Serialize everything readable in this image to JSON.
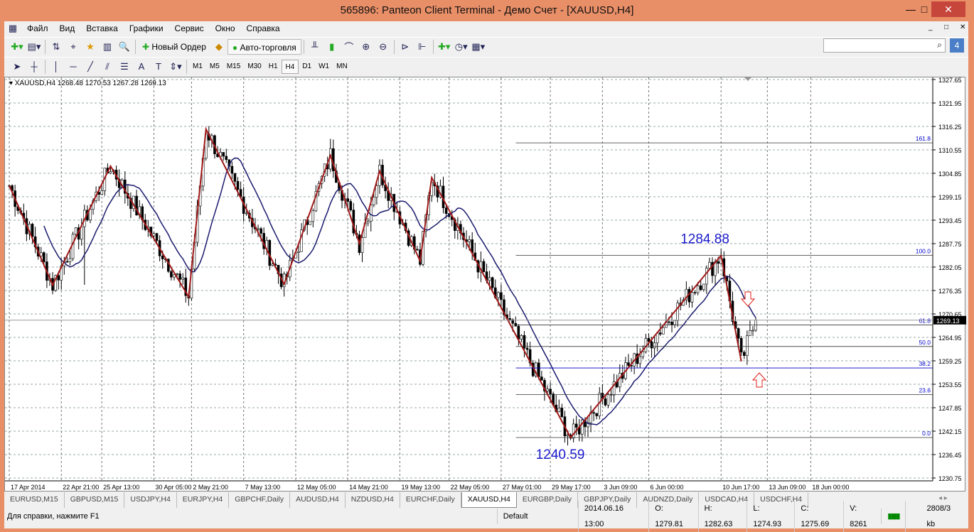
{
  "window": {
    "title": "565896: Panteon Client Terminal - Демо Счет - [XAUUSD,H4]"
  },
  "menu": [
    "Файл",
    "Вид",
    "Вставка",
    "Графики",
    "Сервис",
    "Окно",
    "Справка"
  ],
  "toolbar": {
    "new_order": "Новый Ордер",
    "auto_trading": "Авто-торговля"
  },
  "timeframes": [
    "M1",
    "M5",
    "M15",
    "M30",
    "H1",
    "H4",
    "D1",
    "W1",
    "MN"
  ],
  "active_timeframe": "H4",
  "chart_data": {
    "type": "candlestick",
    "symbol_info": "XAUUSD,H4  1268.48 1270.53 1267.28 1269.13",
    "y_ticks": [
      "1327.65",
      "1321.95",
      "1316.25",
      "1310.55",
      "1304.85",
      "1299.15",
      "1293.45",
      "1287.75",
      "1282.05",
      "1276.35",
      "1270.65",
      "1264.95",
      "1259.25",
      "1253.55",
      "1247.85",
      "1242.15",
      "1236.45",
      "1230.75"
    ],
    "ylim": [
      1230.75,
      1327.65
    ],
    "x_ticks": [
      "17 Apr 2014",
      "22 Apr 21:00",
      "25 Apr 13:00",
      "30 Apr 05:00",
      "2 May 21:00",
      "7 May 13:00",
      "12 May 05:00",
      "14 May 21:00",
      "19 May 13:00",
      "22 May 05:00",
      "27 May 01:00",
      "29 May 17:00",
      "3 Jun 09:00",
      "6 Jun 00:00",
      "10 Jun 17:00",
      "13 Jun 09:00",
      "18 Jun 00:00"
    ],
    "current_price": "1269.13",
    "zigzag": [
      [
        0,
        1301.9
      ],
      [
        15,
        1277.7
      ],
      [
        35,
        1306.6
      ],
      [
        62,
        1274.8
      ],
      [
        68,
        1315.6
      ],
      [
        95,
        1277.9
      ],
      [
        111,
        1309.2
      ],
      [
        121,
        1287.8
      ],
      [
        128,
        1305.4
      ],
      [
        142,
        1283.5
      ],
      [
        146,
        1303.8
      ],
      [
        194,
        1240.59
      ],
      [
        246,
        1284.88
      ],
      [
        253,
        1259.1
      ],
      [
        258,
        1269.13
      ]
    ],
    "fibonacci": {
      "low": 1240.59,
      "high": 1284.88,
      "levels": [
        "0.0",
        "23.6",
        "38.2",
        "50.0",
        "61.8",
        "100.0",
        "161.8"
      ]
    },
    "annotations": {
      "high": "1284.88",
      "low": "1240.59"
    },
    "colors": {
      "zigzag": "#a01818",
      "ma": "#1a1a6e",
      "fib": "#0000cc",
      "annot": "#1a1acc",
      "arrow": "#e0201a"
    }
  },
  "tabs": [
    "EURUSD,M15",
    "GBPUSD,M15",
    "USDJPY,H4",
    "EURJPY,H4",
    "GBPCHF,Daily",
    "AUDUSD,H4",
    "NZDUSD,H4",
    "EURCHF,Daily",
    "XAUUSD,H4",
    "EURGBP,Daily",
    "GBPJPY,Daily",
    "AUDNZD,Daily",
    "USDCAD,H4",
    "USDCHF,H4"
  ],
  "active_tab": "XAUUSD,H4",
  "status": {
    "help": "Для справки, нажмите F1",
    "profile": "Default",
    "time": "2014.06.16 13:00",
    "open": "O: 1279.81",
    "high": "H: 1282.63",
    "low": "L: 1274.93",
    "close": "C: 1275.69",
    "volume": "V: 8261",
    "traffic": "2808/3 kb"
  }
}
